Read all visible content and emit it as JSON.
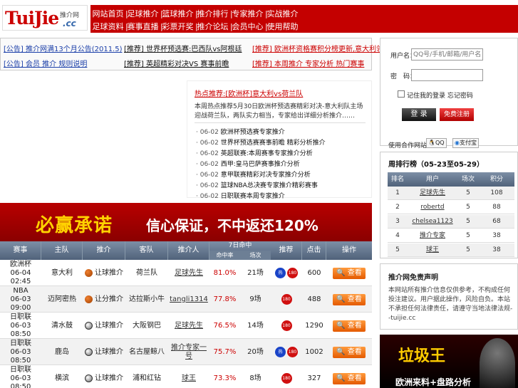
{
  "logo": {
    "text": "TuiJie",
    "sub": "推介网",
    "cc": ".cc"
  },
  "nav": {
    "row1": [
      "网站首页",
      "足球推介",
      "篮球推介",
      "推介排行",
      "专家推介",
      "实战推介"
    ],
    "row2": [
      "足球资料",
      "赛事直播",
      "彩票开奖",
      "推介论坛",
      "会员中心",
      "使用帮助"
    ],
    "sep": "|"
  },
  "news": {
    "a": "[公告] 推介网满13个月公告(2011.5)",
    "b": "[推荐] 世界杯预选赛:巴西队vs阿根廷",
    "c": "[推荐] 欧洲杯资格赛积分榜更新,意大利领先",
    "d": "[公告] 会员 推介 规则说明",
    "e": "[推荐] 英超精彩对决VS 赛事前瞻",
    "f": "[推荐] 本周推介 专家分析 热门赛事"
  },
  "feature": {
    "title": "热点推荐:[欧洲杯]意大利vs荷兰队",
    "desc": "本周热点推荐5月30日欧洲杯预选赛精彩对决-意大利队主场迎战荷兰队，两队实力相当，专家给出详细分析推介……",
    "items": [
      {
        "date": "06-02",
        "text": "欧洲杯预选赛专家推介"
      },
      {
        "date": "06-02",
        "text": "世界杯预选赛赛事前瞻 精彩分析推介"
      },
      {
        "date": "06-02",
        "text": "英超联赛:本周赛事专家推介分析"
      },
      {
        "date": "06-02",
        "text": "西甲:皇马巴萨赛事推介分析"
      },
      {
        "date": "06-02",
        "text": "意甲联赛精彩对决专家推介分析"
      },
      {
        "date": "06-02",
        "text": "篮球NBA总决赛专家推介精彩赛事"
      },
      {
        "date": "06-02",
        "text": "日职联赛本周专家推介"
      }
    ]
  },
  "banner": {
    "left": "必赢承诺",
    "right": "信心保证，不中返还120%"
  },
  "table": {
    "headers": [
      "赛事",
      "主队",
      "推介",
      "客队",
      "推介人",
      "7日命中",
      "",
      "推荐",
      "点击",
      "操作"
    ],
    "sub7": [
      "命中率",
      "场次"
    ],
    "rows": [
      {
        "league": "欧洲杯",
        "date": "06-04",
        "time": "02:45",
        "home": "意大利",
        "rec": "让球推介",
        "away": "荷兰队",
        "user": "足球先生",
        "rate": "81.0%",
        "games": "21场",
        "clicks": "600",
        "sport": "basket",
        "badges": [
          "热",
          "180"
        ]
      },
      {
        "league": "NBA",
        "date": "06-03",
        "time": "09:00",
        "home": "迈阿密热",
        "rec": "让分推介",
        "away": "达拉斯小牛",
        "user": "tangli1314",
        "rate": "77.8%",
        "games": "9场",
        "clicks": "488",
        "sport": "basket",
        "badges": [
          "180"
        ]
      },
      {
        "league": "日职联",
        "date": "06-03",
        "time": "08:50",
        "home": "清水鼓",
        "rec": "让球推介",
        "away": "大阪钢巴",
        "user": "足球先生",
        "rate": "76.5%",
        "games": "14场",
        "clicks": "1290",
        "sport": "soccer",
        "badges": [
          "180"
        ]
      },
      {
        "league": "日职联",
        "date": "06-03",
        "time": "08:50",
        "home": "鹿岛",
        "rec": "让球推介",
        "away": "名古屋鲸八",
        "user": "推介专家一号",
        "rate": "75.7%",
        "games": "20场",
        "clicks": "1002",
        "sport": "soccer",
        "badges": [
          "热",
          "180"
        ]
      },
      {
        "league": "日职联",
        "date": "06-03",
        "time": "08:50",
        "home": "横滨",
        "rec": "让球推介",
        "away": "浦和红钻",
        "user": "球王",
        "rate": "73.3%",
        "games": "8场",
        "clicks": "327",
        "sport": "soccer",
        "badges": [
          "180"
        ]
      }
    ],
    "view_label": "🔍 查看"
  },
  "login": {
    "user_label": "用户名：",
    "user_placeholder": "QQ号/手机/邮箱/用户名",
    "pass_label": "密　码：",
    "remember_label": "记住我的登录 忘记密码",
    "login_btn": "登 录",
    "register_btn": "免费注册",
    "oauth_label": "使用合作网站登录：",
    "qq": "QQ",
    "alipay": "支付宝"
  },
  "rank": {
    "title": "周排行榜（05-23至05-29）",
    "headers": [
      "排名",
      "用户",
      "场次",
      "积分"
    ],
    "rows": [
      [
        "1",
        "足球先生",
        "5",
        "108"
      ],
      [
        "2",
        "robertd",
        "5",
        "88"
      ],
      [
        "3",
        "chelsea1123",
        "5",
        "68"
      ],
      [
        "4",
        "推介专家",
        "5",
        "38"
      ],
      [
        "5",
        "球王",
        "5",
        "38"
      ]
    ]
  },
  "notice": {
    "title": "推介网免责声明",
    "body": "本网站所有推介信息仅供参考，不构成任何投注建议。用户据此操作，风险自负。本站不承担任何法律责任，请遵守当地法律法规--tuijie.cc"
  },
  "ad": {
    "title": "垃圾王",
    "sub": "欧洲来料+盘路分析"
  }
}
